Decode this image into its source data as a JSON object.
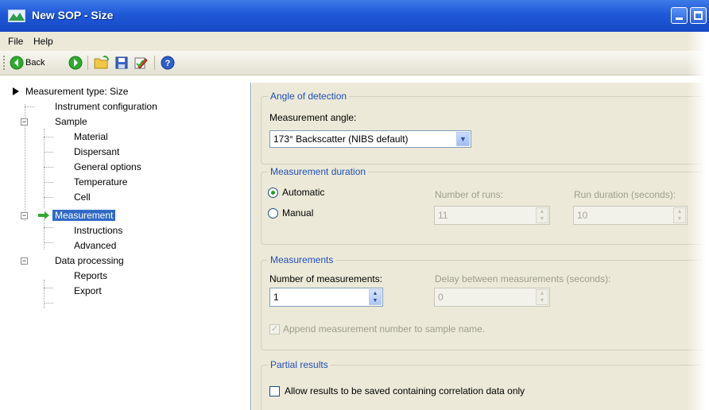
{
  "window": {
    "title": "New SOP - Size"
  },
  "menu": {
    "file": "File",
    "help": "Help"
  },
  "toolbar": {
    "back_label": "Back"
  },
  "tree": {
    "measurement_type": "Measurement type: Size",
    "instrument_configuration": "Instrument configuration",
    "sample": "Sample",
    "material": "Material",
    "dispersant": "Dispersant",
    "general_options": "General options",
    "temperature": "Temperature",
    "cell": "Cell",
    "measurement": "Measurement",
    "instructions": "Instructions",
    "advanced": "Advanced",
    "data_processing": "Data processing",
    "reports": "Reports",
    "export": "Export"
  },
  "angle": {
    "group_title": "Angle of detection",
    "label": "Measurement angle:",
    "selected": "173° Backscatter (NIBS default)"
  },
  "duration": {
    "group_title": "Measurement duration",
    "automatic": "Automatic",
    "manual": "Manual",
    "runs_label": "Number of runs:",
    "runs_value": "11",
    "run_duration_label": "Run duration (seconds):",
    "run_duration_value": "10",
    "selected_mode": "Automatic"
  },
  "measurements": {
    "group_title": "Measurements",
    "count_label": "Number of measurements:",
    "count_value": "1",
    "delay_label": "Delay between measurements (seconds):",
    "delay_value": "0",
    "append_label": "Append measurement number to sample name.",
    "append_checked": true
  },
  "partial": {
    "group_title": "Partial results",
    "allow_label": "Allow results to be saved containing correlation data only",
    "allow_checked": false
  },
  "colors": {
    "title_bar": "#1f58d8",
    "selection": "#316ac5",
    "group_title": "#1f4fb6",
    "panel": "#ece9d8"
  }
}
